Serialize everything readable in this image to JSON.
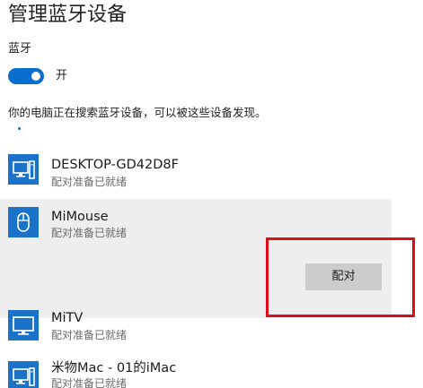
{
  "page": {
    "title": "管理蓝牙设备"
  },
  "bluetooth": {
    "section_label": "蓝牙",
    "toggle_state": "on",
    "toggle_label": "开",
    "discover_text": "你的电脑正在搜索蓝牙设备，可以被这些设备发现。"
  },
  "devices": [
    {
      "name": "DESKTOP-GD42D8F",
      "status": "配对准备已就绪",
      "icon": "desktop-icon"
    },
    {
      "name": "MiMouse",
      "status": "配对准备已就绪",
      "icon": "mouse-icon",
      "selected": true
    },
    {
      "name": "MiTV",
      "status": "配对准备已就绪",
      "icon": "monitor-icon"
    },
    {
      "name": "米物Mac - 01的iMac",
      "status": "配对准备已就绪",
      "icon": "desktop-icon"
    }
  ],
  "actions": {
    "pair_label": "配对"
  },
  "colors": {
    "accent": "#0a6ecf",
    "icon_tile": "#1a73c8",
    "selected_row": "#eeeeee",
    "pair_button": "#cccccc",
    "highlight": "#d90f1a"
  }
}
